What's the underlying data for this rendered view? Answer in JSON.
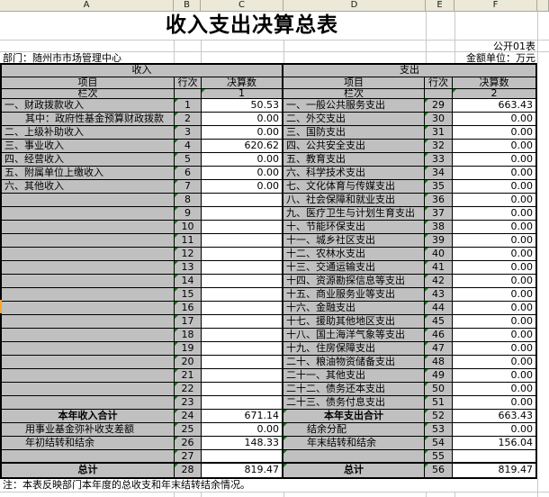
{
  "sheet": {
    "column_headers": [
      "A",
      "B",
      "C",
      "D",
      "E",
      "F"
    ]
  },
  "header": {
    "title": "收入支出决算总表",
    "doc_label": "公开01表",
    "department": "部门：随州市市场管理中心",
    "unit_label": "金额单位：万元"
  },
  "table": {
    "sections": {
      "income": "收入",
      "expense": "支出"
    },
    "columns": {
      "item": "项目",
      "line": "行次",
      "amount": "决算数"
    },
    "lanci": {
      "label": "栏次",
      "income_col": "1",
      "expense_col": "2"
    },
    "income_rows": [
      {
        "item": "一、财政拨款收入",
        "line": "1",
        "amount": "50.53"
      },
      {
        "item": "其中：政府性基金预算财政拨款",
        "line": "2",
        "amount": "0.00",
        "style": "indent"
      },
      {
        "item": "二、上级补助收入",
        "line": "3",
        "amount": "0.00"
      },
      {
        "item": "三、事业收入",
        "line": "4",
        "amount": "620.62"
      },
      {
        "item": "四、经营收入",
        "line": "5",
        "amount": "0.00"
      },
      {
        "item": "五、附属单位上缴收入",
        "line": "6",
        "amount": "0.00"
      },
      {
        "item": "六、其他收入",
        "line": "7",
        "amount": "0.00"
      },
      {
        "item": "",
        "line": "8",
        "amount": ""
      },
      {
        "item": "",
        "line": "9",
        "amount": ""
      },
      {
        "item": "",
        "line": "10",
        "amount": ""
      },
      {
        "item": "",
        "line": "11",
        "amount": ""
      },
      {
        "item": "",
        "line": "12",
        "amount": ""
      },
      {
        "item": "",
        "line": "13",
        "amount": ""
      },
      {
        "item": "",
        "line": "14",
        "amount": ""
      },
      {
        "item": "",
        "line": "15",
        "amount": ""
      },
      {
        "item": "",
        "line": "16",
        "amount": ""
      },
      {
        "item": "",
        "line": "17",
        "amount": ""
      },
      {
        "item": "",
        "line": "18",
        "amount": ""
      },
      {
        "item": "",
        "line": "19",
        "amount": ""
      },
      {
        "item": "",
        "line": "20",
        "amount": ""
      },
      {
        "item": "",
        "line": "21",
        "amount": ""
      },
      {
        "item": "",
        "line": "22",
        "amount": ""
      },
      {
        "item": "",
        "line": "23",
        "amount": ""
      },
      {
        "item": "本年收入合计",
        "line": "24",
        "amount": "671.14",
        "style": "total"
      },
      {
        "item": "用事业基金弥补收支差额",
        "line": "25",
        "amount": "0.00",
        "style": "indent"
      },
      {
        "item": "年初结转和结余",
        "line": "26",
        "amount": "148.33",
        "style": "indent"
      },
      {
        "item": "",
        "line": "27",
        "amount": ""
      },
      {
        "item": "总计",
        "line": "28",
        "amount": "819.47",
        "style": "total"
      }
    ],
    "expense_rows": [
      {
        "item": "一、一般公共服务支出",
        "line": "29",
        "amount": "663.43"
      },
      {
        "item": "二、外交支出",
        "line": "30",
        "amount": "0.00"
      },
      {
        "item": "三、国防支出",
        "line": "31",
        "amount": "0.00"
      },
      {
        "item": "四、公共安全支出",
        "line": "32",
        "amount": "0.00"
      },
      {
        "item": "五、教育支出",
        "line": "33",
        "amount": "0.00"
      },
      {
        "item": "六、科学技术支出",
        "line": "34",
        "amount": "0.00"
      },
      {
        "item": "七、文化体育与传媒支出",
        "line": "35",
        "amount": "0.00"
      },
      {
        "item": "八、社会保障和就业支出",
        "line": "36",
        "amount": "0.00"
      },
      {
        "item": "九、医疗卫生与计划生育支出",
        "line": "37",
        "amount": "0.00"
      },
      {
        "item": "十、节能环保支出",
        "line": "38",
        "amount": "0.00"
      },
      {
        "item": "十一、城乡社区支出",
        "line": "39",
        "amount": "0.00"
      },
      {
        "item": "十二、农林水支出",
        "line": "40",
        "amount": "0.00"
      },
      {
        "item": "十三、交通运输支出",
        "line": "41",
        "amount": "0.00"
      },
      {
        "item": "十四、资源勘探信息等支出",
        "line": "42",
        "amount": "0.00"
      },
      {
        "item": "十五、商业服务业等支出",
        "line": "43",
        "amount": "0.00"
      },
      {
        "item": "十六、金融支出",
        "line": "44",
        "amount": "0.00"
      },
      {
        "item": "十七、援助其他地区支出",
        "line": "45",
        "amount": "0.00"
      },
      {
        "item": "十八、国土海洋气象等支出",
        "line": "46",
        "amount": "0.00"
      },
      {
        "item": "十九、住房保障支出",
        "line": "47",
        "amount": "0.00"
      },
      {
        "item": "二十、粮油物资储备支出",
        "line": "48",
        "amount": "0.00"
      },
      {
        "item": "二十一、其他支出",
        "line": "49",
        "amount": "0.00"
      },
      {
        "item": "二十二、债务还本支出",
        "line": "50",
        "amount": "0.00"
      },
      {
        "item": "二十三、债务付息支出",
        "line": "51",
        "amount": "0.00"
      },
      {
        "item": "本年支出合计",
        "line": "52",
        "amount": "663.43",
        "style": "total",
        "tri_item": true
      },
      {
        "item": "结余分配",
        "line": "53",
        "amount": "0.00",
        "style": "indent",
        "tri_item": true
      },
      {
        "item": "年末结转和结余",
        "line": "54",
        "amount": "156.04",
        "style": "indent",
        "tri_item": true
      },
      {
        "item": "",
        "line": "55",
        "amount": "",
        "tri_item": true
      },
      {
        "item": "总计",
        "line": "56",
        "amount": "819.47",
        "style": "total",
        "tri_item": true
      }
    ]
  },
  "note": "注：本表反映部门本年度的总收支和年末结转结余情况。"
}
